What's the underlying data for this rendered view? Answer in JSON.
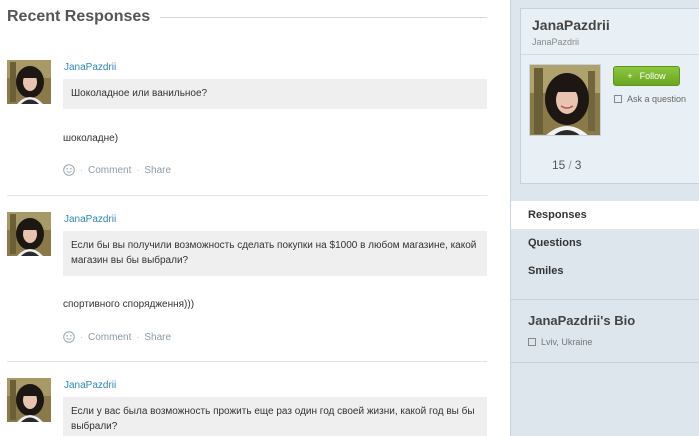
{
  "page": {
    "section_title": "Recent Responses"
  },
  "responses": [
    {
      "username": "JanaPazdrii",
      "question": "Шоколадное или ванильное?",
      "answer": "шоколадне)",
      "comment_label": "Comment",
      "share_label": "Share"
    },
    {
      "username": "JanaPazdrii",
      "question": "Если бы вы получили возможность сделать покупки на $1000 в любом магазине, какой магазин вы бы выбрали?",
      "answer": "спортивного спорядження)))",
      "comment_label": "Comment",
      "share_label": "Share"
    },
    {
      "username": "JanaPazdrii",
      "question": "Если у вас была возможность прожить еще раз один год своей жизни, какой год вы бы выбрали?"
    }
  ],
  "sidebar": {
    "profile_name": "JanaPazdrii",
    "profile_handle": "JanaPazdrii",
    "follow_label": "Follow",
    "ask_label": "Ask a question",
    "count_a": "15",
    "count_separator": "/",
    "count_b": "3",
    "nav": [
      {
        "label": "Responses",
        "active": true
      },
      {
        "label": "Questions",
        "active": false
      },
      {
        "label": "Smiles",
        "active": false
      }
    ],
    "bio_title": "JanaPazdrii's Bio",
    "bio_location": "Lviv, Ukraine"
  },
  "colors": {
    "link": "#2e87b8",
    "follow_button": "#7ab82e",
    "sidebar_bg": "#dde6ed",
    "question_bg": "#efefef"
  },
  "icons": [
    "smile-icon",
    "plus-icon",
    "ask-icon",
    "location-icon"
  ]
}
